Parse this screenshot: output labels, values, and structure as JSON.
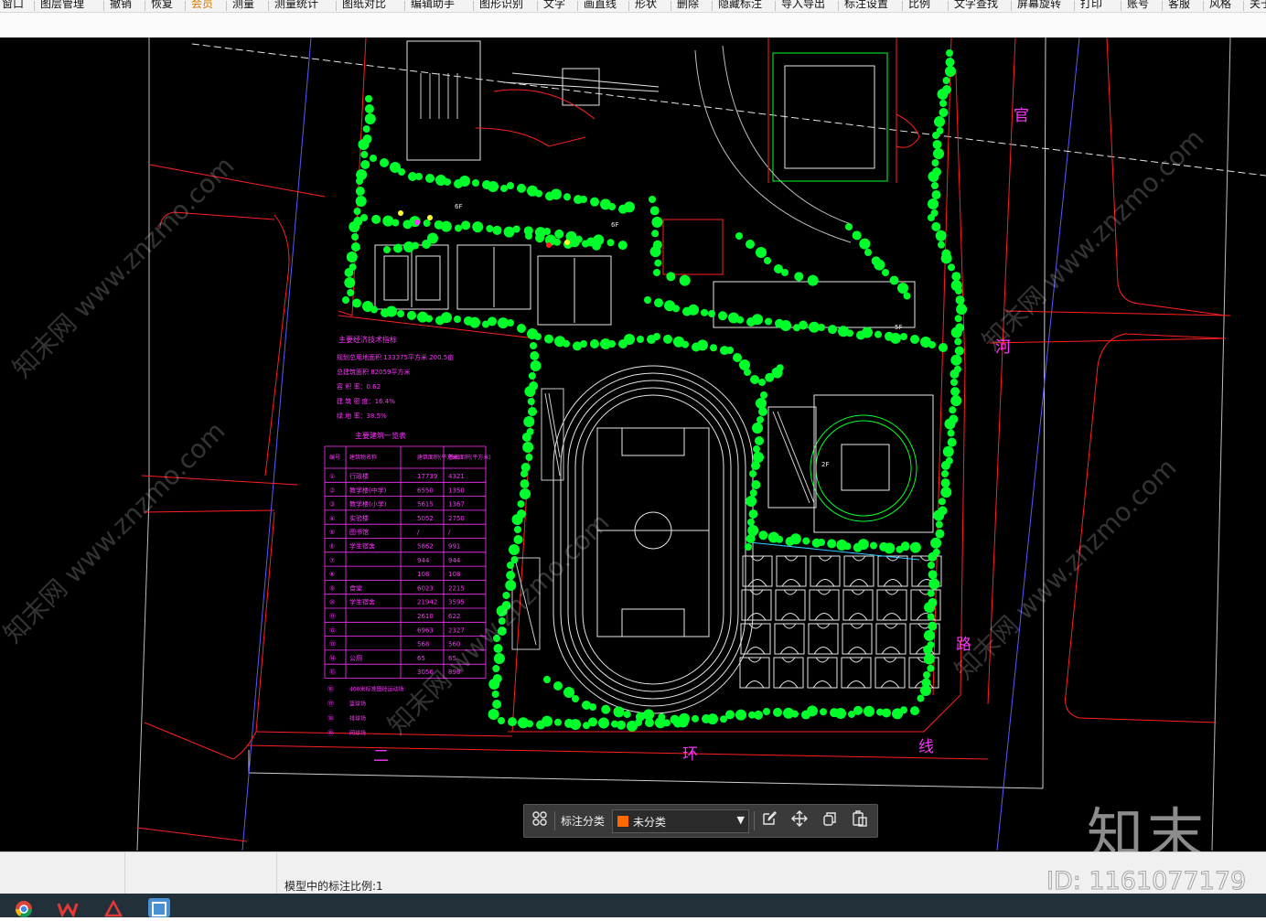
{
  "menu": {
    "items": [
      "窗口",
      "图层管理",
      "撤销",
      "恢复",
      "会员",
      "测量",
      "测量统计",
      "图纸对比",
      "编辑助手",
      "图形识别",
      "文字",
      "画直线",
      "形状",
      "删除",
      "隐藏标注",
      "导入导出",
      "标注设置",
      "比例",
      "文字查找",
      "屏幕旋转",
      "打印",
      "账号",
      "客服",
      "风格",
      "关于"
    ]
  },
  "drawing": {
    "road_chars": [
      "官",
      "河",
      "路",
      "二",
      "环",
      "线"
    ],
    "text1_title": "主要经济技术指标",
    "text1_lines": [
      "规划总用地面积  133375平方米 200.5亩",
      "总建筑面积  82059平方米",
      "容 积 率：0.62",
      "建 筑 密 度：16.4%",
      "绿 地 率：38.5%"
    ],
    "table_title": "主要建筑一览表",
    "table_header": [
      "编号",
      "建筑物名称",
      "建筑面积(平方米)",
      "基底面积(平方米)"
    ],
    "table_rows": [
      [
        "①",
        "行政楼",
        "17739",
        "4321"
      ],
      [
        "②",
        "教学楼(中学)",
        "6550",
        "1350"
      ],
      [
        "③",
        "教学楼(小学)",
        "5615",
        "1367"
      ],
      [
        "④",
        "实验楼",
        "5052",
        "2750"
      ],
      [
        "⑤",
        "图书馆",
        "/",
        "/"
      ],
      [
        "⑥",
        "学生宿舍",
        "5862",
        "991"
      ],
      [
        "⑦",
        "",
        "944",
        "944"
      ],
      [
        "⑧",
        "",
        "108",
        "108"
      ],
      [
        "⑨",
        "食堂",
        "6023",
        "2215"
      ],
      [
        "⑩",
        "学生宿舍",
        "21942",
        "3595"
      ],
      [
        "⑪",
        "",
        "2610",
        "622"
      ],
      [
        "⑫",
        "",
        "6963",
        "2327"
      ],
      [
        "⑬",
        "",
        "568",
        "560"
      ],
      [
        "⑭",
        "公厕",
        "65",
        "65"
      ],
      [
        "⑮",
        "",
        "3056",
        "898"
      ]
    ],
    "table_tail": [
      [
        "⑯",
        "400米标准田径运动场"
      ],
      [
        "⑰",
        "篮球场"
      ],
      [
        "⑱",
        "排球场"
      ],
      [
        "⑲",
        "网球场"
      ]
    ],
    "building_labels": [
      "6F",
      "6F",
      "5F",
      "2F"
    ]
  },
  "annotation_toolbar": {
    "label": "标注分类",
    "selected_category": "未分类",
    "swatch_color": "#ff6a00",
    "buttons": [
      "edit-icon",
      "move-icon",
      "copy-icon",
      "paste-icon"
    ]
  },
  "status": {
    "scale_text": "模型中的标注比例:1"
  },
  "watermark": {
    "logo": "知末",
    "id": "ID: 1161077179",
    "diagonal": "知末网 www.znzmo.com"
  },
  "colors": {
    "green": "#00ff2a",
    "magenta": "#ff33ff",
    "red": "#ff2020",
    "white_line": "#e6e6e6",
    "blue": "#5a5aff"
  }
}
